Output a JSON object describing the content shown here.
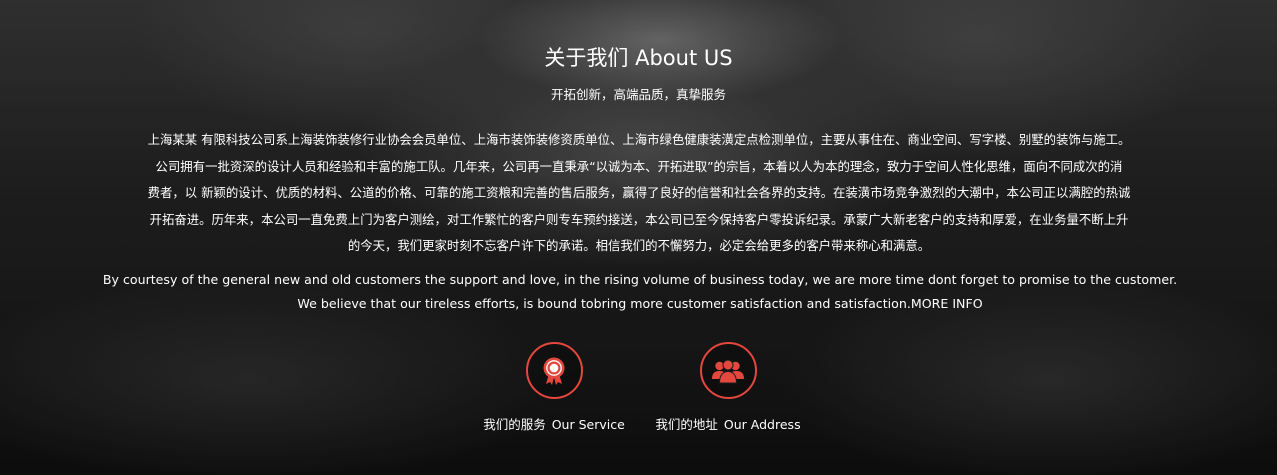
{
  "about": {
    "title": "关于我们 About US",
    "subtitle": "开拓创新，高端品质，真挚服务",
    "cn_lines": [
      "上海某某 有限科技公司系上海装饰装修行业协会会员单位、上海市装饰装修资质单位、上海市绿色健康装潢定点检测单位，主要从事住在、商业空间、写字楼、别墅的装饰与施工。",
      "公司拥有一批资深的设计人员和经验和丰富的施工队。几年来，公司再一直秉承“以诚为本、开拓进取”的宗旨，本着以人为本的理念，致力于空间人性化思维，面向不同成次的消",
      "费者，以 新颖的设计、优质的材料、公道的价格、可靠的施工资粮和完善的售后服务，赢得了良好的信誉和社会各界的支持。在装潢市场竞争激烈的大潮中，本公司正以满腔的热诚",
      "开拓奋进。历年来，本公司一直免费上门为客户测绘，对工作繁忙的客户则专车预约接送，本公司已至今保持客户零投诉纪录。承蒙广大新老客户的支持和厚爱，在业务量不断上升",
      "的今天，我们更家时刻不忘客户许下的承诺。相信我们的不懈努力，必定会给更多的客户带来称心和满意。"
    ],
    "en_line1": "By courtesy of the general new and old customers the support and love, in the rising volume of business today, we are more time dont forget to promise to the customer.",
    "en_line2": "We believe that our tireless efforts, is bound tobring more customer satisfaction and satisfaction.",
    "more_link": "MORE INFO"
  },
  "features": [
    {
      "cn": "我们的服务",
      "en": "Our Service",
      "icon": "award-ribbon-icon"
    },
    {
      "cn": "我们的地址",
      "en": "Our Address",
      "icon": "users-group-icon"
    }
  ],
  "colors": {
    "accent": "#e3473d",
    "text": "#ffffff"
  }
}
